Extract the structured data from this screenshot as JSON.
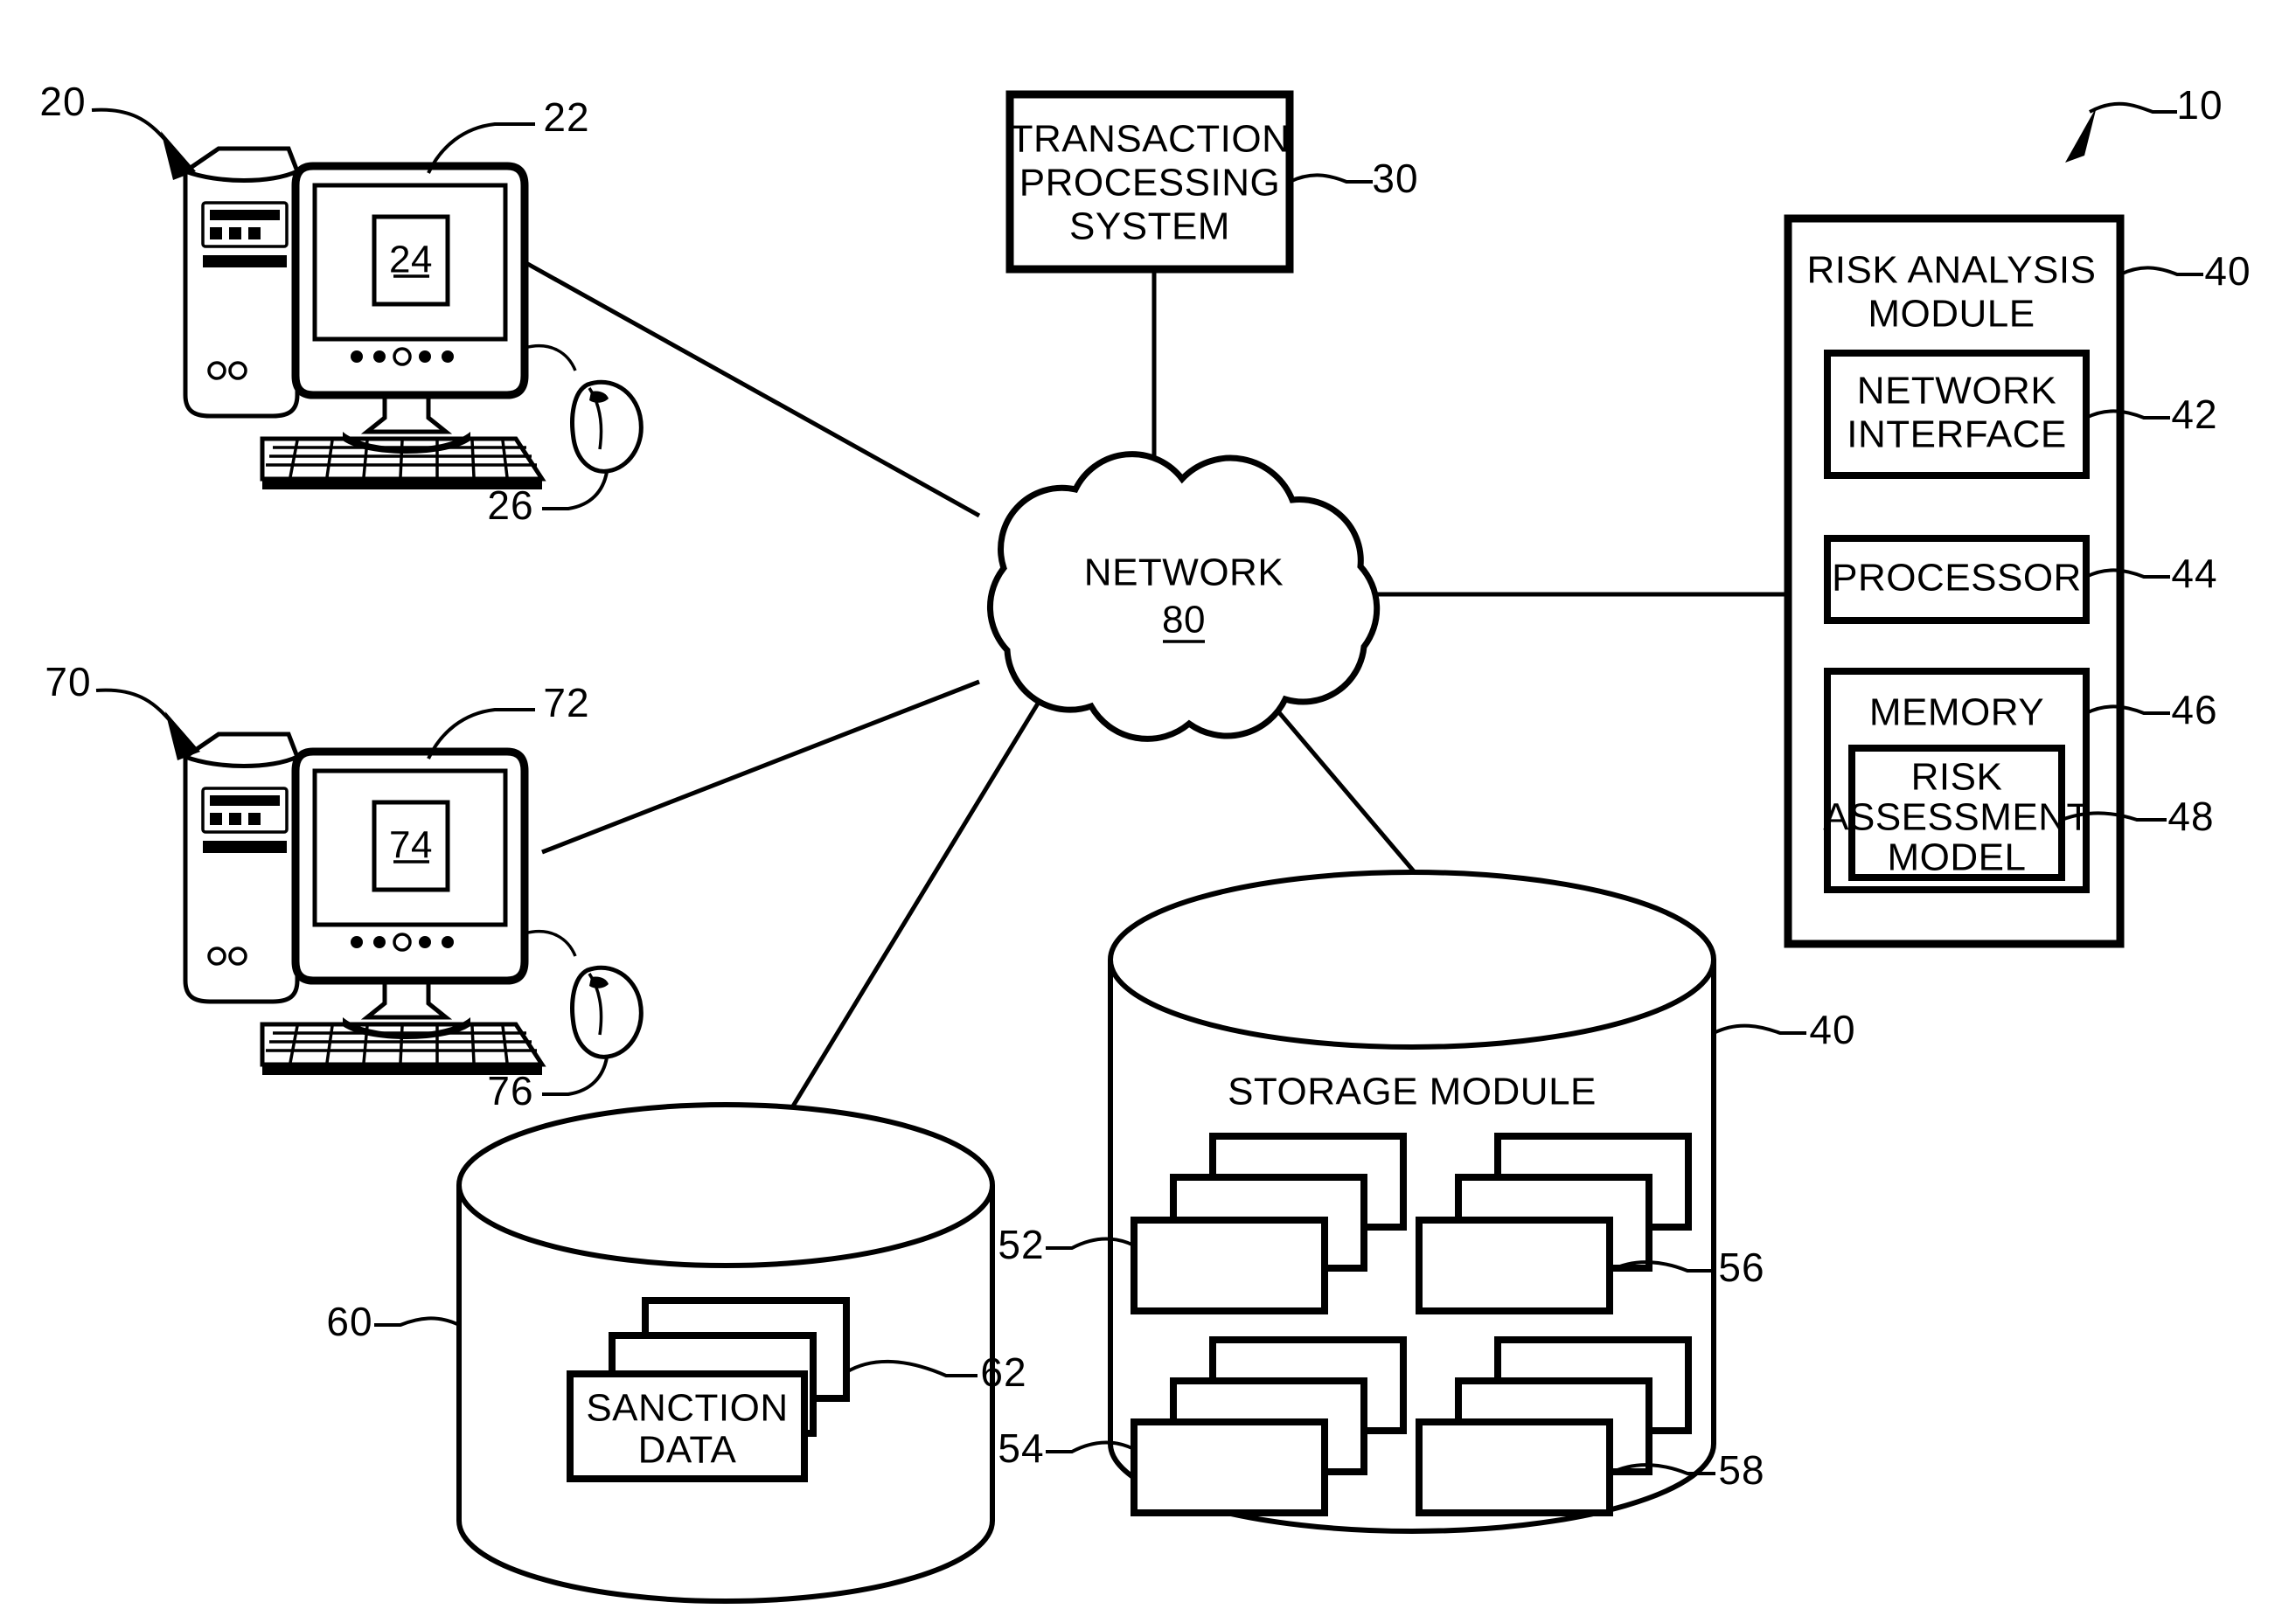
{
  "figure": {
    "title": "Risk analysis system block diagram",
    "system_ref": "10"
  },
  "workstation_1": {
    "ref": "20",
    "monitor_ref": "22",
    "screen_ref": "24",
    "mouse_ref": "26"
  },
  "workstation_2": {
    "ref": "70",
    "monitor_ref": "72",
    "screen_ref": "74",
    "mouse_ref": "76"
  },
  "transaction_processing_system": {
    "line1": "TRANSACTION",
    "line2": "PROCESSING",
    "line3": "SYSTEM",
    "ref": "30"
  },
  "network": {
    "label": "NETWORK",
    "ref": "80"
  },
  "risk_analysis_module": {
    "line1": "RISK ANALYSIS",
    "line2": "MODULE",
    "ref": "40",
    "network_interface": {
      "line1": "NETWORK",
      "line2": "INTERFACE",
      "ref": "42"
    },
    "processor": {
      "label": "PROCESSOR",
      "ref": "44"
    },
    "memory": {
      "label": "MEMORY",
      "ref": "46",
      "risk_assessment_model": {
        "line1": "RISK",
        "line2": "ASSESSMENT",
        "line3": "MODEL",
        "ref": "48"
      }
    }
  },
  "sanction_database": {
    "ref": "60",
    "stack_ref": "62",
    "card": {
      "line1": "SANCTION",
      "line2": "DATA"
    }
  },
  "storage_module": {
    "label": "STORAGE MODULE",
    "ref": "40",
    "stack_refs": {
      "top_left": "52",
      "bottom_left": "54",
      "top_right": "56",
      "bottom_right": "58"
    }
  },
  "colors": {
    "ink": "#000000",
    "paper": "#ffffff"
  }
}
